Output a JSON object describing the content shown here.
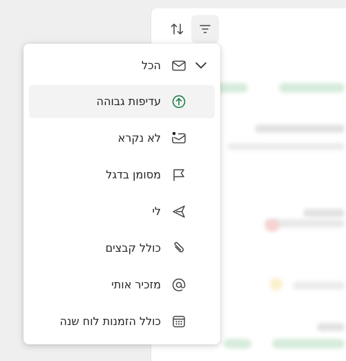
{
  "toolbar": {
    "sort_icon": "sort-arrows-icon",
    "filter_icon": "filter-lines-icon"
  },
  "filter_menu": {
    "items": [
      {
        "label": "הכל",
        "icon": "mail-icon",
        "checked": true
      },
      {
        "label": "עדיפות גבוהה",
        "icon": "arrow-up-circle-icon",
        "highlighted": true
      },
      {
        "label": "לא נקרא",
        "icon": "mail-unread-icon"
      },
      {
        "label": "מסומן בדגל",
        "icon": "flag-icon"
      },
      {
        "label": "לי",
        "icon": "send-icon"
      },
      {
        "label": "כולל קבצים",
        "icon": "paperclip-icon"
      },
      {
        "label": "מזכיר אותי",
        "icon": "mention-icon"
      },
      {
        "label": "כולל הזמנות לוח שנה",
        "icon": "calendar-icon"
      }
    ]
  },
  "colors": {
    "accent_green": "#0e7a3e",
    "menu_bg": "#ffffff",
    "selected_bg": "#f3f3f3"
  }
}
